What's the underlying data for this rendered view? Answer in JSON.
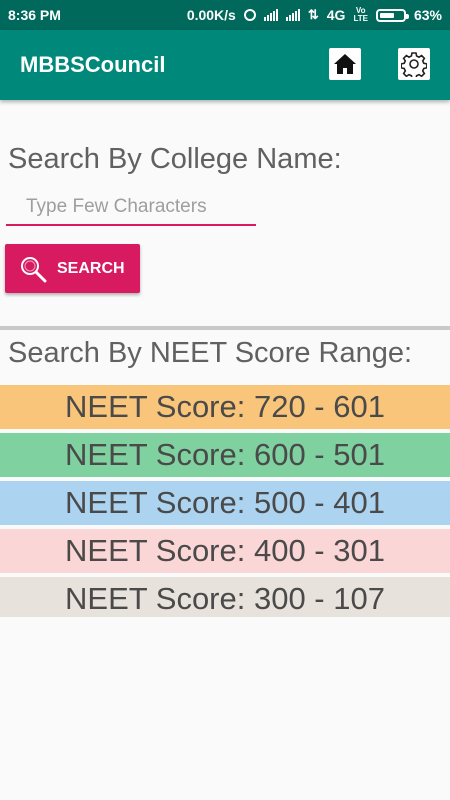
{
  "status_bar": {
    "time": "8:36 PM",
    "speed": "0.00K/s",
    "network": "4G",
    "volte_top": "Vo",
    "volte_bottom": "LTE",
    "battery_percent": 63,
    "battery_label": "63%"
  },
  "app_bar": {
    "title": "MBBSCouncil",
    "home_icon": "home-icon",
    "settings_icon": "gear-icon"
  },
  "college_search": {
    "label": "Search By College Name:",
    "input_value": "",
    "placeholder": "Type Few Characters",
    "button_label": "SEARCH",
    "button_icon": "magnifier-icon"
  },
  "score_search": {
    "label": "Search By NEET Score Range:",
    "ranges": [
      {
        "label": "NEET Score: 720 - 601",
        "color": "#f9c57a"
      },
      {
        "label": "NEET Score: 600 - 501",
        "color": "#7fd1a0"
      },
      {
        "label": "NEET Score: 500 - 401",
        "color": "#acd3f0"
      },
      {
        "label": "NEET Score: 400 - 301",
        "color": "#fbd6d6"
      },
      {
        "label": "NEET Score: 300 - 107",
        "color": "#e8e2dc"
      }
    ]
  },
  "colors": {
    "status_bar": "#00695c",
    "app_bar": "#00897b",
    "accent": "#d81b60",
    "divider": "#c8c8c8"
  }
}
